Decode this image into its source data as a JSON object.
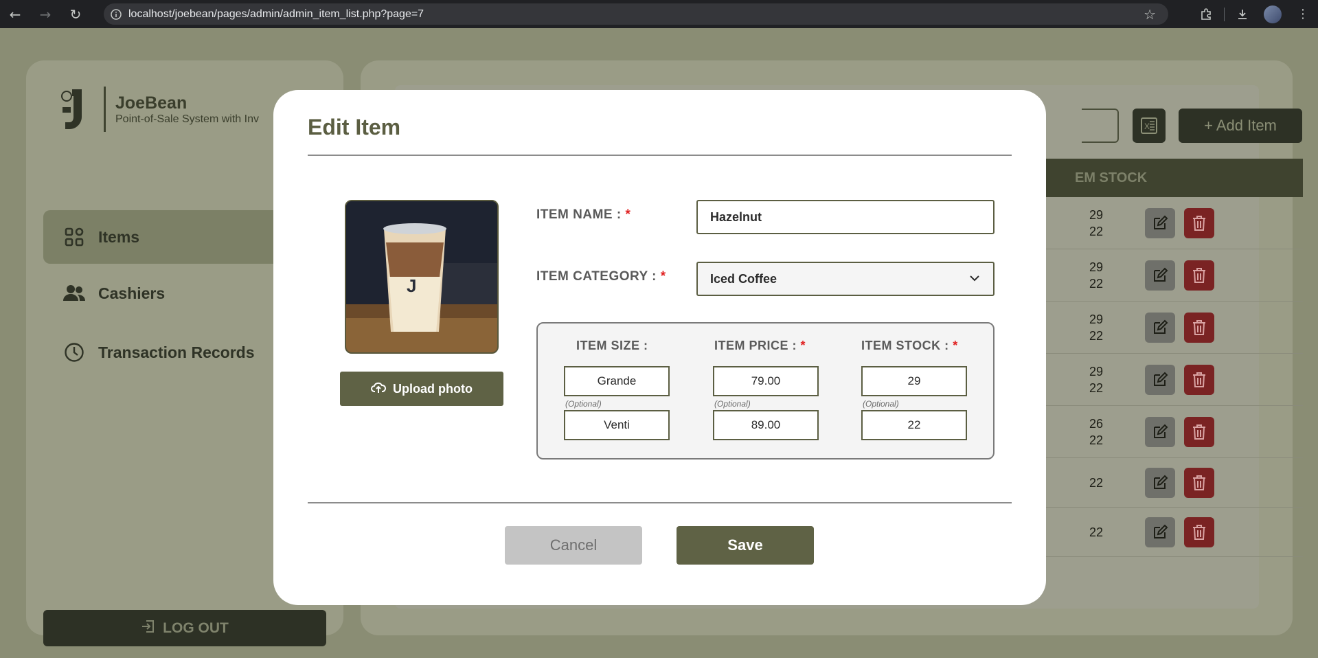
{
  "browser": {
    "url": "localhost/joebean/pages/admin/admin_item_list.php?page=7"
  },
  "brand": {
    "name": "JoeBean",
    "tagline": "Point-of-Sale System with Inv"
  },
  "sidebar": {
    "items": [
      {
        "label": "Items",
        "icon": "grid-icon"
      },
      {
        "label": "Cashiers",
        "icon": "users-icon"
      },
      {
        "label": "Transaction Records",
        "icon": "clock-icon"
      }
    ],
    "logout_label": "LOG OUT"
  },
  "toolbar": {
    "add_item_label": "+ Add Item"
  },
  "table": {
    "stock_header": "EM STOCK",
    "rows": [
      {
        "stock": [
          "29",
          "22"
        ]
      },
      {
        "stock": [
          "29",
          "22"
        ]
      },
      {
        "stock": [
          "29",
          "22"
        ]
      },
      {
        "stock": [
          "29",
          "22"
        ]
      },
      {
        "stock": [
          "26",
          "22"
        ]
      },
      {
        "stock": [
          "22"
        ]
      },
      {
        "stock": [
          "22"
        ]
      }
    ]
  },
  "modal": {
    "title": "Edit Item",
    "item_name_label": "ITEM NAME :",
    "item_name_value": "Hazelnut",
    "item_category_label": "ITEM CATEGORY :",
    "item_category_value": "Iced Coffee",
    "upload_label": "Upload photo",
    "size_header": "ITEM SIZE :",
    "price_header": "ITEM PRICE :",
    "stock_header": "ITEM STOCK :",
    "required_mark": "*",
    "optional_label": "(Optional)",
    "variants": [
      {
        "size": "Grande",
        "price": "79.00",
        "stock": "29"
      },
      {
        "size": "Venti",
        "price": "89.00",
        "stock": "22"
      }
    ],
    "cancel_label": "Cancel",
    "save_label": "Save"
  },
  "colors": {
    "accent": "#5f6245",
    "required": "#e02020",
    "delete": "#7a2323",
    "overlay_bg": "#8a8d74"
  }
}
